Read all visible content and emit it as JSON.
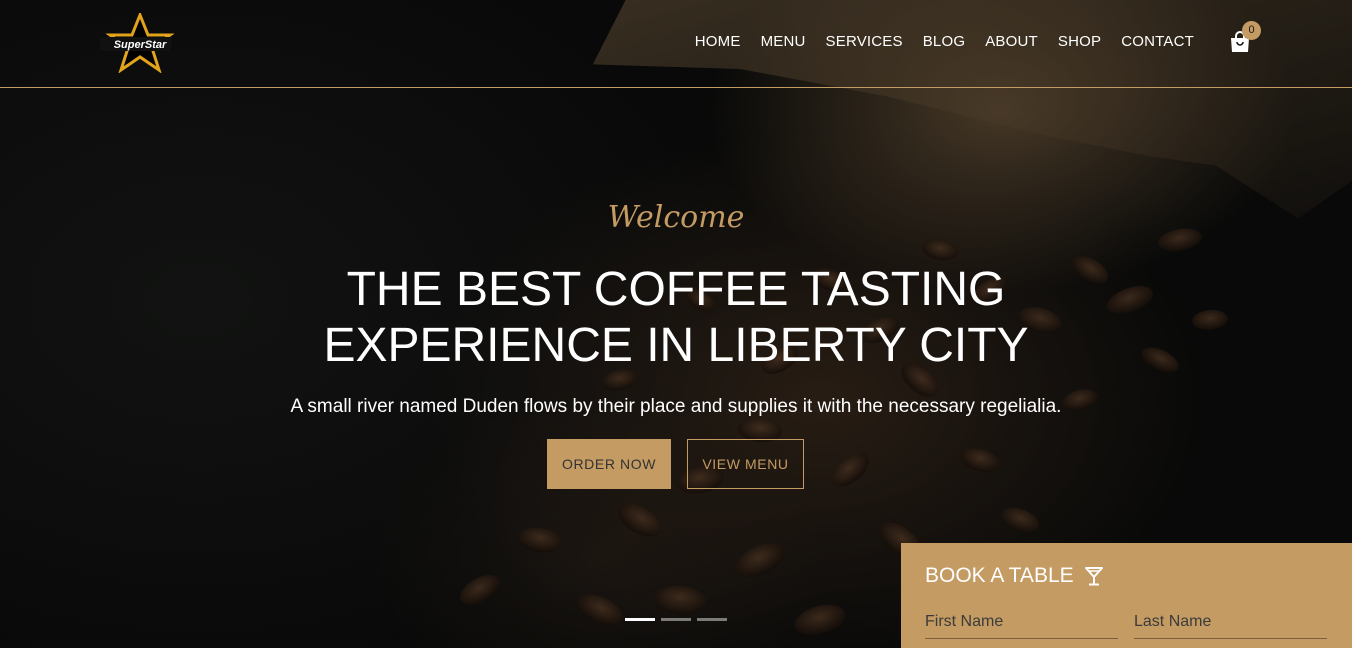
{
  "brand": {
    "logo_text": "SuperStar",
    "accent": "#c49b63"
  },
  "nav": {
    "items": [
      "HOME",
      "MENU",
      "SERVICES",
      "BLOG",
      "ABOUT",
      "SHOP",
      "CONTACT"
    ],
    "cart_icon": "shopping-bag-icon",
    "cart_count": "0"
  },
  "hero": {
    "welcome": "Welcome",
    "headline_line1": "THE BEST COFFEE TASTING",
    "headline_line2": "EXPERIENCE IN LIBERTY CITY",
    "subtitle": "A small river named Duden flows by their place and supplies it with the necessary regelialia.",
    "order_button": "ORDER NOW",
    "menu_button": "VIEW MENU",
    "slides": 3,
    "active_slide": 1
  },
  "booking": {
    "title": "BOOK A TABLE",
    "title_icon": "cocktail-glass-icon",
    "first_name_placeholder": "First Name",
    "last_name_placeholder": "Last Name"
  }
}
